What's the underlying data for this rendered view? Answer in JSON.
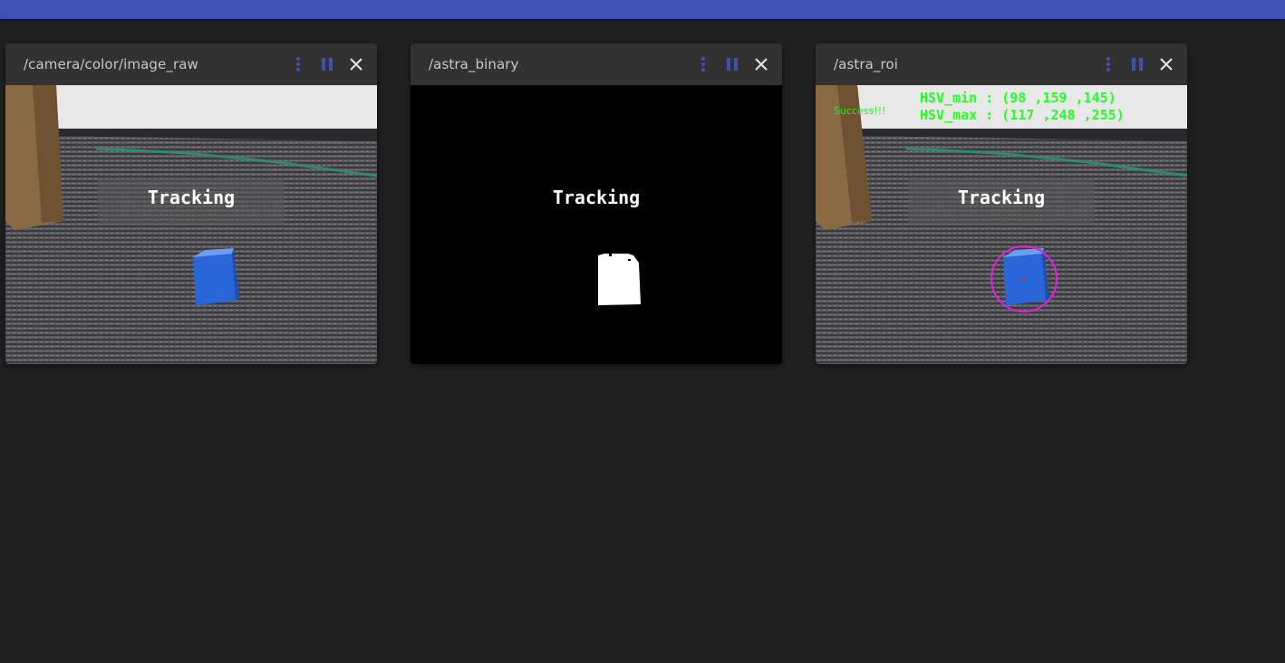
{
  "app": {
    "accent_color": "#3f51b5",
    "background_color": "#202020"
  },
  "panels": [
    {
      "title": "/camera/color/image_raw",
      "overlay_label": "Tracking",
      "icons": {
        "menu": "more-vert-icon",
        "pause": "pause-icon",
        "close": "close-icon"
      }
    },
    {
      "title": "/astra_binary",
      "overlay_label": "Tracking",
      "icons": {
        "menu": "more-vert-icon",
        "pause": "pause-icon",
        "close": "close-icon"
      }
    },
    {
      "title": "/astra_roi",
      "overlay_label": "Tracking",
      "status_text": "Success!!!",
      "hsv_min": "HSV_min : (98 ,159 ,145)",
      "hsv_max": "HSV_max : (117 ,248 ,255)",
      "icons": {
        "menu": "more-vert-icon",
        "pause": "pause-icon",
        "close": "close-icon"
      }
    }
  ]
}
